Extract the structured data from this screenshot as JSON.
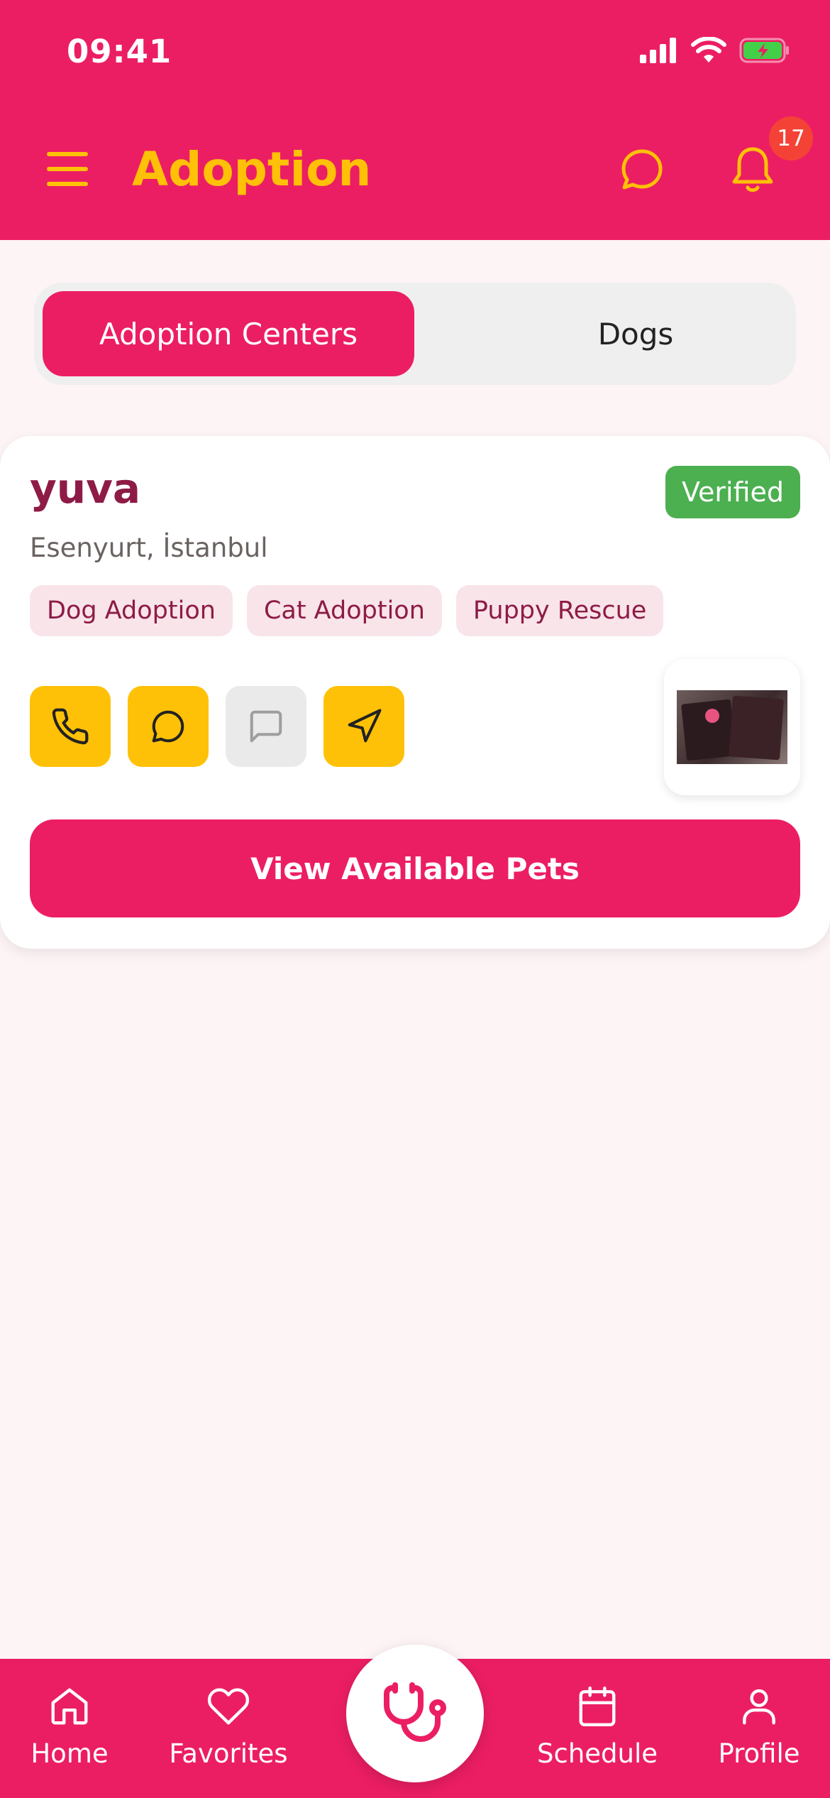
{
  "status_bar": {
    "time": "09:41"
  },
  "header": {
    "title": "Adoption",
    "notification_count": "17"
  },
  "segments": [
    {
      "label": "Adoption Centers",
      "active": true
    },
    {
      "label": "Dogs",
      "active": false
    }
  ],
  "center": {
    "name": "yuva",
    "badge": "Verified",
    "location": "Esenyurt, İstanbul",
    "tags": [
      "Dog Adoption",
      "Cat Adoption",
      "Puppy Rescue"
    ],
    "actions": [
      {
        "icon": "phone-icon",
        "enabled": true
      },
      {
        "icon": "whatsapp-icon",
        "enabled": true
      },
      {
        "icon": "message-icon",
        "enabled": false
      },
      {
        "icon": "navigation-icon",
        "enabled": true
      }
    ],
    "cta": "View Available Pets"
  },
  "tabbar": {
    "items": [
      {
        "label": "Home",
        "icon": "home-icon"
      },
      {
        "label": "Favorites",
        "icon": "heart-icon"
      },
      {
        "label": "",
        "icon": "stethoscope-icon"
      },
      {
        "label": "Schedule",
        "icon": "calendar-icon"
      },
      {
        "label": "Profile",
        "icon": "user-icon"
      }
    ]
  },
  "colors": {
    "primary": "#EC1E63",
    "accent": "#FFC107",
    "verified": "#4CAF50",
    "title": "#8E1B46",
    "background": "#FDF4F5"
  }
}
